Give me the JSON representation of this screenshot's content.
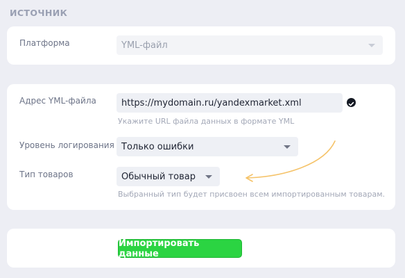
{
  "section_title": "ИСТОЧНИК",
  "platform": {
    "label": "Платформа",
    "value": "YML-файл"
  },
  "yml_address": {
    "label": "Адрес YML-файла",
    "value": "https://mydomain.ru/yandexmarket.xml",
    "hint": "Укажите URL файла данных в формате YML"
  },
  "logging_level": {
    "label": "Уровень логирования",
    "value": "Только ошибки"
  },
  "product_type": {
    "label": "Тип товаров",
    "value": "Обычный товар",
    "hint": "Выбранный тип будет присвоен всем импортированным товарам."
  },
  "import_button": {
    "label": "Импортировать данные"
  },
  "colors": {
    "accent_green": "#2bd442",
    "annotation_arrow": "#f5c36a",
    "background": "#edeef4"
  }
}
